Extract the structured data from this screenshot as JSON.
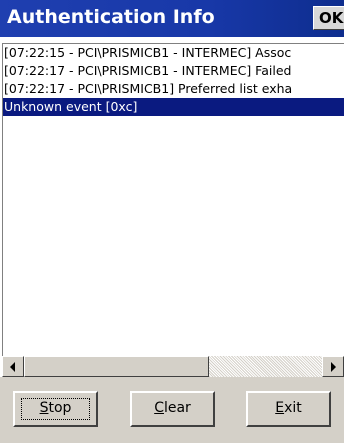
{
  "window": {
    "title": "Authentication Info",
    "ok_label": "OK"
  },
  "log": {
    "rows": [
      "[07:22:15 - PCI\\PRISMICB1 - INTERMEC]  Assoc",
      "[07:22:17 - PCI\\PRISMICB1 - INTERMEC]  Failed",
      "[07:22:17 - PCI\\PRISMICB1]  Preferred list exha",
      "Unknown event [0xc]"
    ],
    "selected_index": 3
  },
  "scrollbar": {
    "left_icon": "arrow-left-icon",
    "right_icon": "arrow-right-icon"
  },
  "buttons": {
    "stop": {
      "mnemonic": "S",
      "rest": "top"
    },
    "clear": {
      "mnemonic": "C",
      "rest": "lear"
    },
    "exit": {
      "mnemonic": "E",
      "rest": "xit"
    }
  },
  "colors": {
    "titlebar": "#1f3fb0",
    "selection": "#0a1a80",
    "face": "#d4d0c8"
  }
}
